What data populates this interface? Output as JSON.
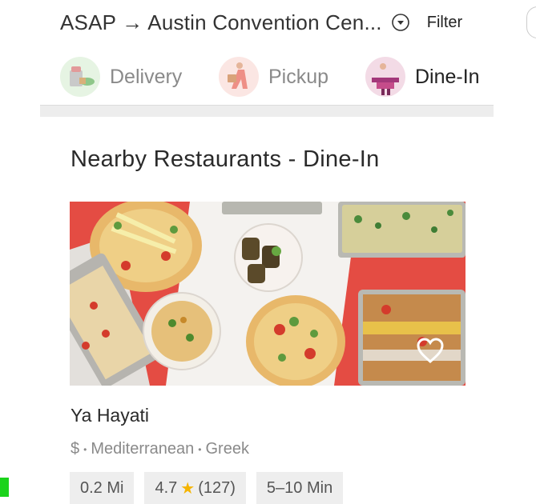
{
  "header": {
    "location": "ASAP → Austin Convention Cen...",
    "filter_label": "Filter"
  },
  "tabs": [
    {
      "label": "Delivery",
      "icon": "delivery-bag-icon",
      "active": false
    },
    {
      "label": "Pickup",
      "icon": "pickup-person-icon",
      "active": false
    },
    {
      "label": "Dine-In",
      "icon": "dine-in-table-icon",
      "active": true
    }
  ],
  "section": {
    "title": "Nearby Restaurants - Dine-In"
  },
  "restaurant": {
    "name": "Ya Hayati",
    "price": "$",
    "cuisines": [
      "Mediterranean",
      "Greek"
    ],
    "distance": "0.2 Mi",
    "rating": "4.7",
    "review_count": "(127)",
    "eta": "5–10 Min"
  },
  "colors": {
    "accent_star": "#f5b400",
    "hero_background": "#e84b3f",
    "pill_background": "#eeeeee",
    "marker": "#1bd31b"
  }
}
